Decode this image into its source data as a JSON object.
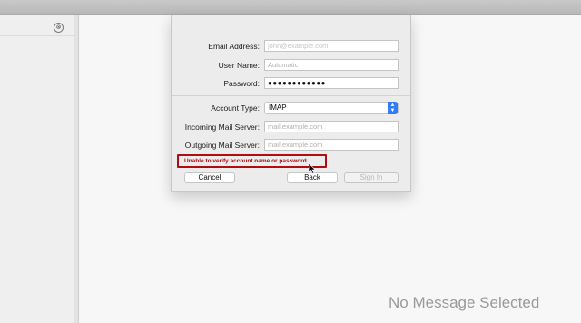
{
  "main": {
    "empty_state": "No Message Selected"
  },
  "sidebar": {
    "collapse_glyph": "⊗"
  },
  "dialog": {
    "email": {
      "label": "Email Address:",
      "value": "john@example.com"
    },
    "username": {
      "label": "User Name:",
      "placeholder": "Automatic"
    },
    "password": {
      "label": "Password:",
      "value": "●●●●●●●●●●●●"
    },
    "account_type": {
      "label": "Account Type:",
      "value": "IMAP"
    },
    "incoming": {
      "label": "Incoming Mail Server:",
      "placeholder": "mail.example.com"
    },
    "outgoing": {
      "label": "Outgoing Mail Server:",
      "placeholder": "mail.example.com"
    },
    "error": "Unable to verify account name or password.",
    "buttons": {
      "cancel": "Cancel",
      "back": "Back",
      "sign_in": "Sign In"
    }
  },
  "colors": {
    "error": "#b20c12",
    "accent": "#2f7ef5"
  }
}
